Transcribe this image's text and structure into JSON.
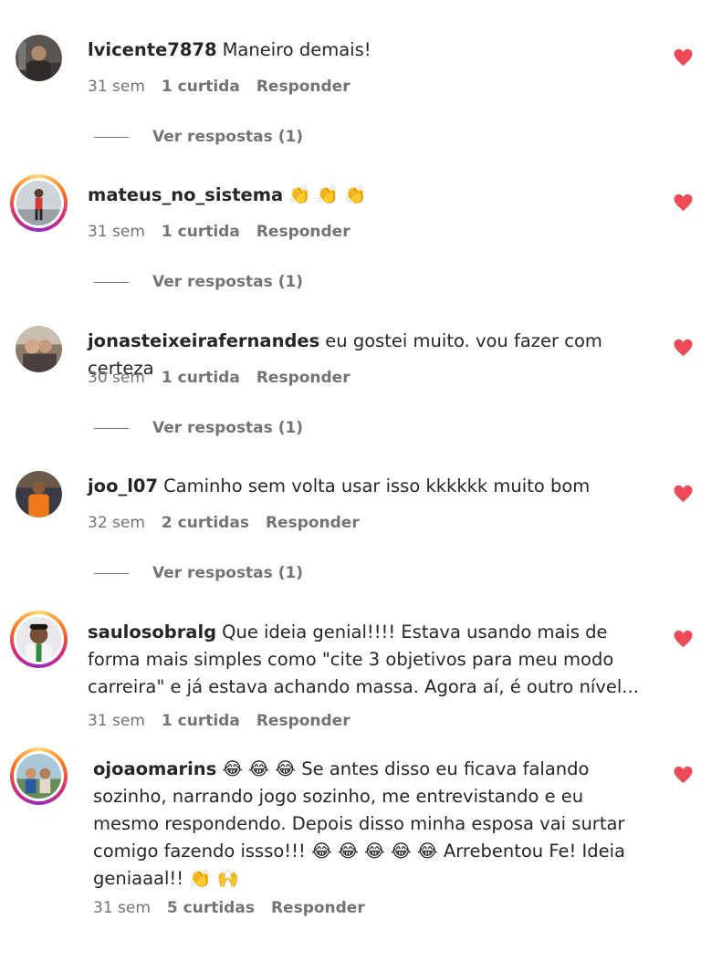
{
  "colors": {
    "heart": "#ed4956",
    "secondary_text": "#737373",
    "primary_text": "#262626",
    "story_ring_gradient": [
      "#feda75",
      "#fa7e1e",
      "#d62976",
      "#962fbf"
    ]
  },
  "icons": {
    "heart": "heart-icon",
    "clap_emoji": "👏",
    "laugh_emoji": "😂",
    "raised_hands_emoji": "🙌"
  },
  "comments": [
    {
      "username": "lvicente7878",
      "text": "Maneiro demais!",
      "time": "31 sem",
      "likes": "1 curtida",
      "reply": "Responder",
      "view_replies": "Ver respostas (1)",
      "story_ring": false
    },
    {
      "username": "mateus_no_sistema",
      "text": "👏 👏 👏",
      "time": "31 sem",
      "likes": "1 curtida",
      "reply": "Responder",
      "view_replies": "Ver respostas (1)",
      "story_ring": true
    },
    {
      "username": "jonasteixeirafernandes",
      "text": "eu gostei muito. vou fazer com certeza",
      "time": "30 sem",
      "likes": "1 curtida",
      "reply": "Responder",
      "view_replies": "Ver respostas (1)",
      "story_ring": false
    },
    {
      "username": "joo_l07",
      "text": "Caminho sem volta usar isso kkkkkk muito bom",
      "time": "32 sem",
      "likes": "2 curtidas",
      "reply": "Responder",
      "view_replies": "Ver respostas (1)",
      "story_ring": false
    },
    {
      "username": "saulosobralg",
      "text": "Que ideia genial!!!! Estava usando mais de forma mais simples como \"cite 3 objetivos para meu modo carreira\" e já estava achando massa. Agora aí, é outro nível...",
      "time": "31 sem",
      "likes": "1 curtida",
      "reply": "Responder",
      "story_ring": true
    },
    {
      "username": "ojoaomarins",
      "text": "😂 😂 😂  Se antes disso eu ficava falando sozinho, narrando jogo sozinho, me entrevistando e eu mesmo respondendo. Depois disso minha esposa vai surtar comigo fazendo issso!!! 😂 😂 😂 😂 😂  Arrebentou Fe! Ideia geniaaal!! 👏 🙌",
      "time": "31 sem",
      "likes": "5 curtidas",
      "reply": "Responder",
      "story_ring": true
    }
  ]
}
